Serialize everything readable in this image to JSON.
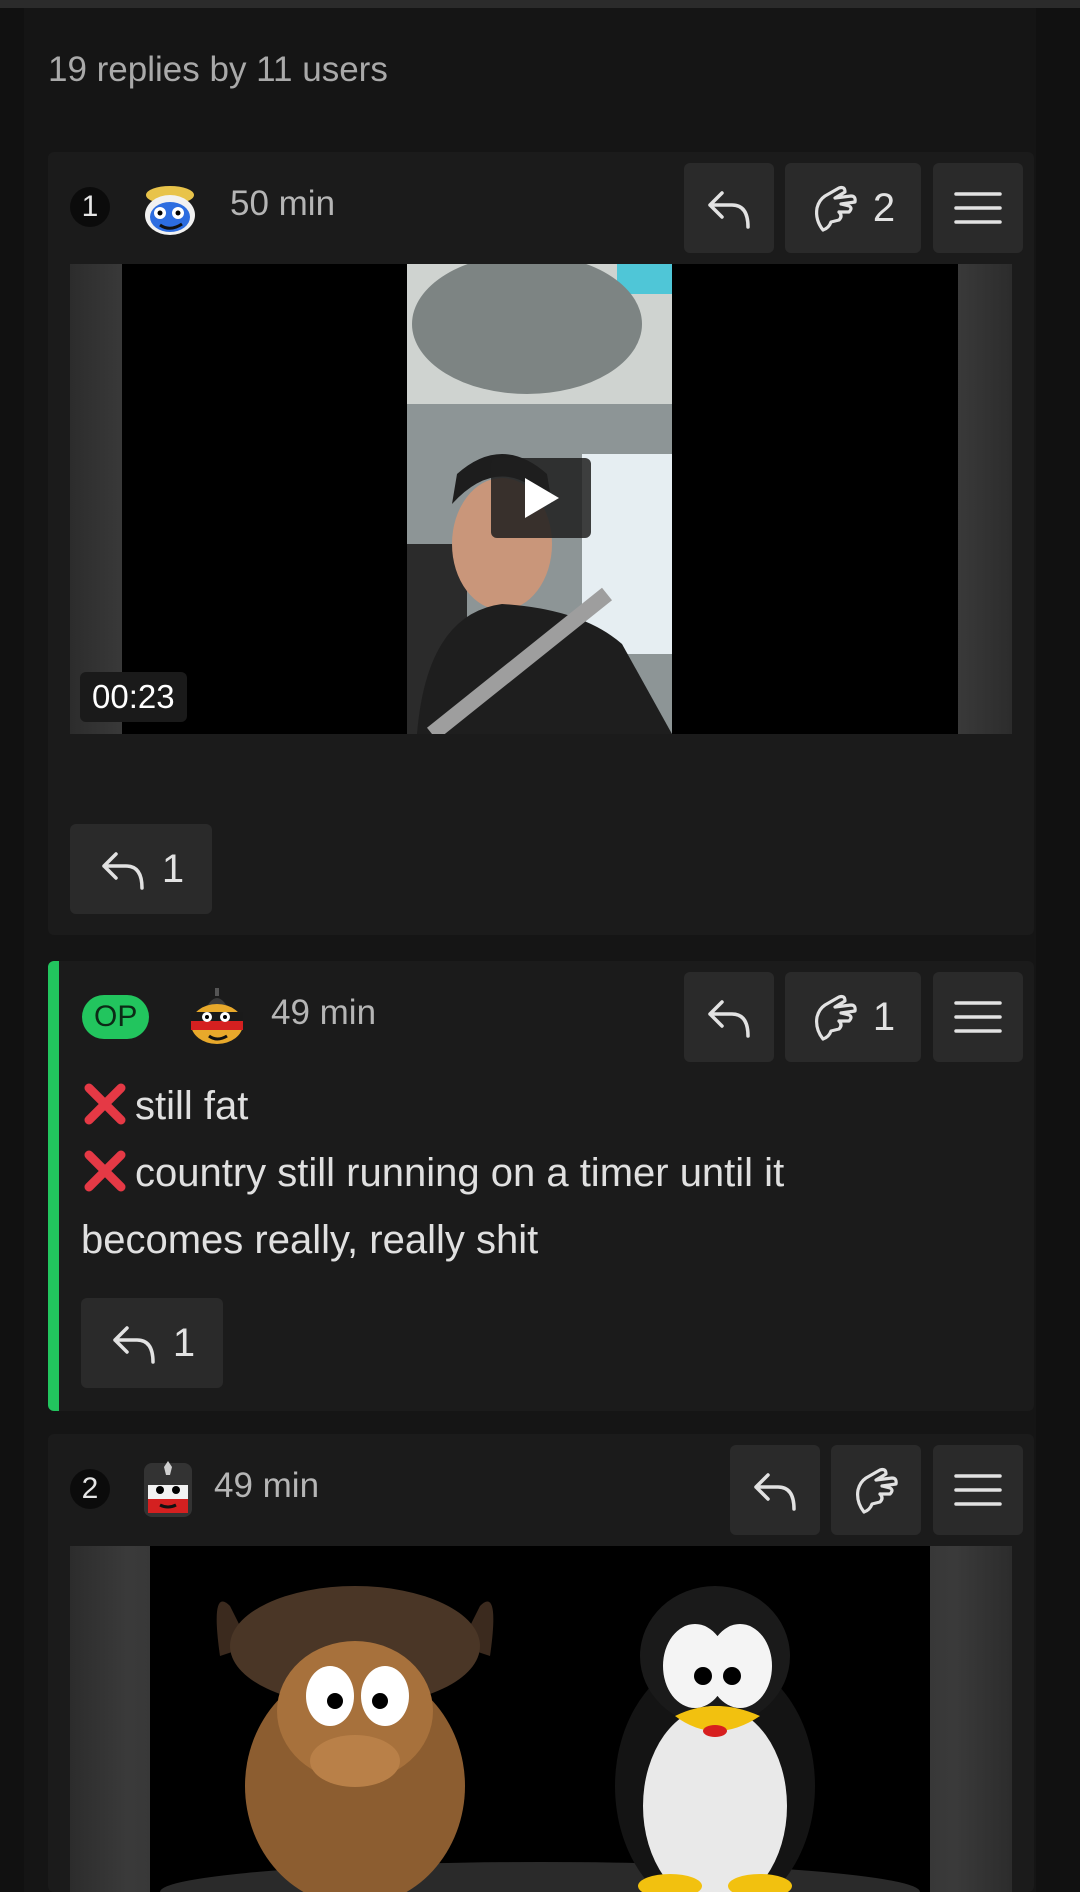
{
  "thread": {
    "summary": "19 replies by 11 users"
  },
  "posts": [
    {
      "number": "1",
      "time": "50 min",
      "like_count": "2",
      "media": {
        "type": "video",
        "duration": "00:23"
      },
      "replies_count": "1"
    },
    {
      "badge": "OP",
      "time": "49 min",
      "like_count": "1",
      "text_lines": [
        "still fat",
        "country still running on a timer until it",
        "becomes really, really shit"
      ],
      "replies_count": "1"
    },
    {
      "number": "2",
      "time": "49 min",
      "media": {
        "type": "image"
      }
    }
  ],
  "icons": {
    "reply": "reply-arrow-icon",
    "like": "pointing-hand-icon",
    "menu": "hamburger-menu-icon",
    "play": "play-icon",
    "cross": "red-x-icon"
  },
  "colors": {
    "accent_green": "#22c55e",
    "cross_red": "#e53945",
    "background": "#111111",
    "card": "#1b1b1b"
  }
}
